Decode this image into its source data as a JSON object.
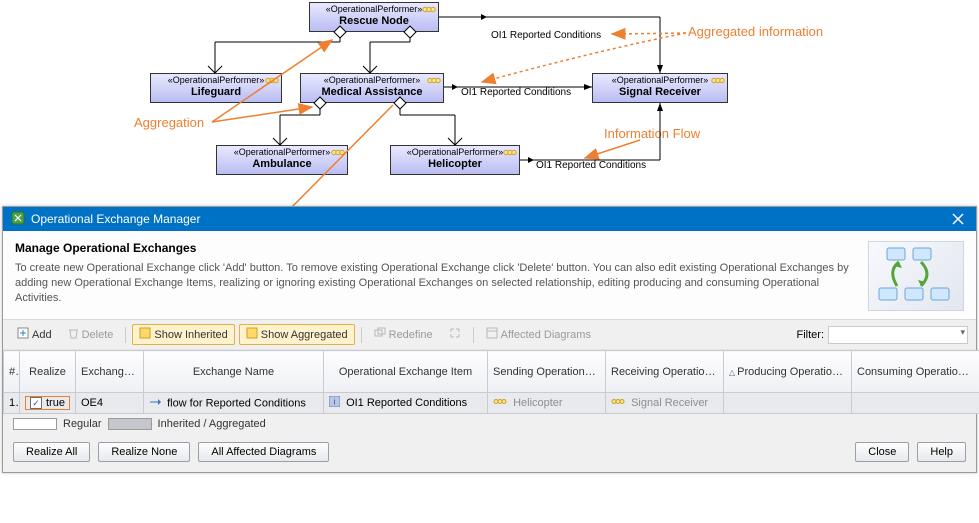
{
  "diagram": {
    "boxes": {
      "rescue": {
        "stereo": "«OperationalPerformer»",
        "name": "Rescue Node"
      },
      "lifeguard": {
        "stereo": "«OperationalPerformer»",
        "name": "Lifeguard"
      },
      "medical": {
        "stereo": "«OperationalPerformer»",
        "name": "Medical Assistance"
      },
      "signal": {
        "stereo": "«OperationalPerformer»",
        "name": "Signal Receiver"
      },
      "ambulance": {
        "stereo": "«OperationalPerformer»",
        "name": "Ambulance"
      },
      "helicopter": {
        "stereo": "«OperationalPerformer»",
        "name": "Helicopter"
      }
    },
    "flow_labels": {
      "l1": "OI1 Reported Conditions",
      "l2": "OI1 Reported Conditions",
      "l3": "OI1 Reported Conditions"
    },
    "annotations": {
      "agg_info": "Aggregated information",
      "aggregation": "Aggregation",
      "info_flow": "Information Flow"
    }
  },
  "dialog": {
    "title": "Operational Exchange Manager",
    "section_title": "Manage Operational Exchanges",
    "description": "To create new Operational Exchange click 'Add' button. To remove existing Operational Exchange click 'Delete' button. You can also edit existing Operational Exchanges by adding new Operational Exchange Items, realizing or ignoring existing Operational Exchanges on selected relationship, editing producing and consuming Operational Activities.",
    "toolbar": {
      "add": "Add",
      "delete": "Delete",
      "show_inherited": "Show Inherited",
      "show_aggregated": "Show Aggregated",
      "redefine": "Redefine",
      "affected": "Affected Diagrams",
      "filter_label": "Filter:"
    },
    "columns": {
      "idx": "#",
      "realize": "Realize",
      "exid": "Exchange ID",
      "exname": "Exchange Name",
      "item": "Operational Exchange Item",
      "send": "Sending Operational Agent",
      "recv": "Receiving Operational Agent",
      "prod": "Producing Operational Activity",
      "cons": "Consuming Operational Activity"
    },
    "row1": {
      "idx": "1",
      "realize": "true",
      "exid": "OE4",
      "exname": "flow for Reported Conditions",
      "item": "OI1 Reported Conditions",
      "send": "Helicopter",
      "recv": "Signal Receiver",
      "prod": "",
      "cons": ""
    },
    "legend": {
      "regular": "Regular",
      "inherited": "Inherited / Aggregated"
    },
    "footer": {
      "realize_all": "Realize All",
      "realize_none": "Realize None",
      "all_affected": "All Affected Diagrams",
      "close": "Close",
      "help": "Help"
    }
  }
}
